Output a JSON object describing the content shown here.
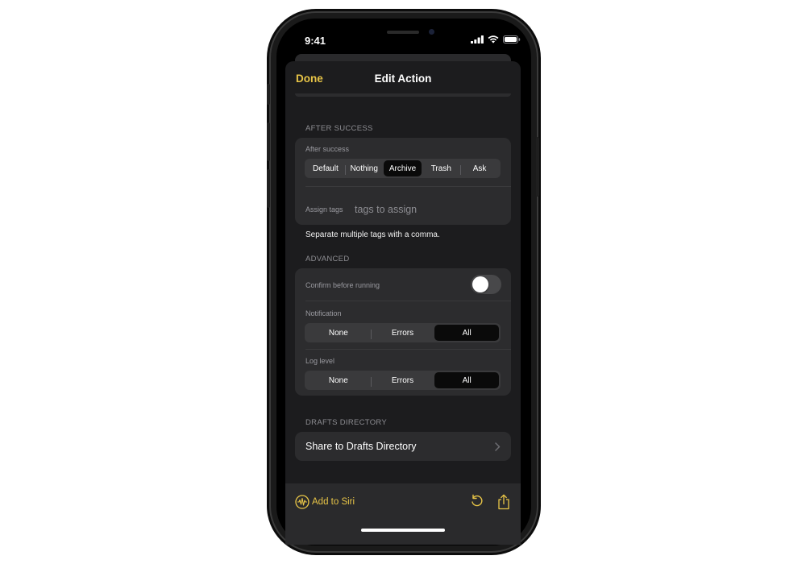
{
  "status_bar": {
    "time": "9:41",
    "icons": [
      "cellular-signal-icon",
      "wifi-icon",
      "battery-icon"
    ]
  },
  "nav": {
    "done_label": "Done",
    "title": "Edit Action"
  },
  "after_success_section": {
    "header": "AFTER SUCCESS",
    "field_label": "After success",
    "options": [
      "Default",
      "Nothing",
      "Archive",
      "Trash",
      "Ask"
    ],
    "selected": "Archive",
    "assign_tags_label": "Assign tags",
    "assign_tags_placeholder": "tags to assign",
    "assign_tags_value": "",
    "footnote": "Separate multiple tags with a comma."
  },
  "advanced_section": {
    "header": "ADVANCED",
    "confirm_label": "Confirm before running",
    "confirm_enabled": false,
    "notification_label": "Notification",
    "notification_options": [
      "None",
      "Errors",
      "All"
    ],
    "notification_selected": "All",
    "log_level_label": "Log level",
    "log_level_options": [
      "None",
      "Errors",
      "All"
    ],
    "log_level_selected": "All"
  },
  "drafts_directory_section": {
    "header": "DRAFTS DIRECTORY",
    "share_label": "Share to Drafts Directory"
  },
  "toolbar": {
    "siri_label": "Add to Siri",
    "icons": [
      "siri-waveform-icon",
      "undo-icon",
      "share-icon"
    ]
  },
  "colors": {
    "accent": "#e8c547",
    "sheet_background": "#1c1c1e",
    "group_background": "#2c2c2e",
    "secondary_text": "#8d8d92"
  }
}
